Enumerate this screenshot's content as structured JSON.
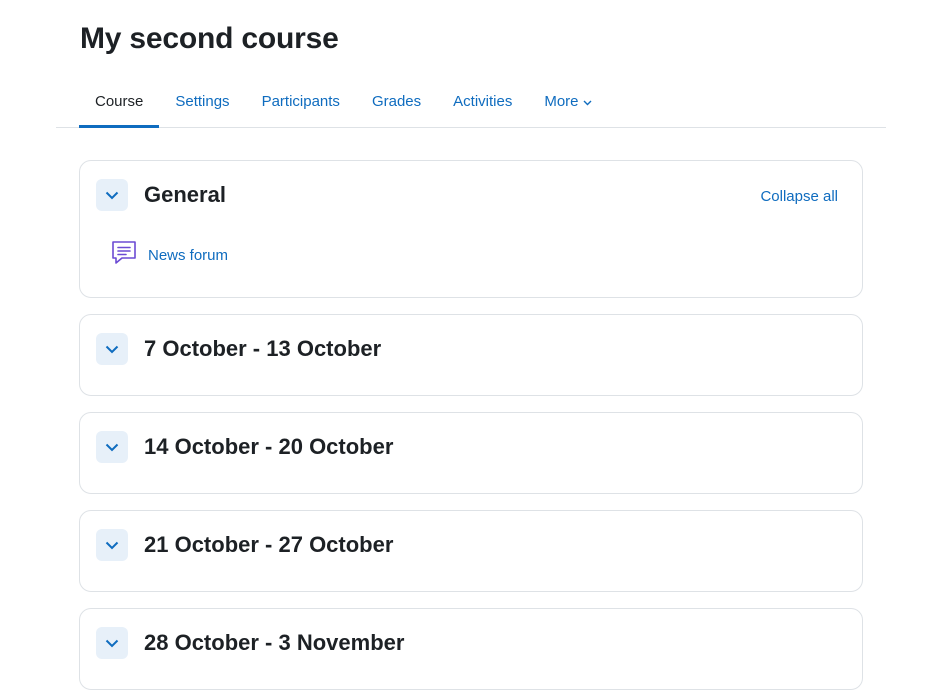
{
  "course": {
    "title": "My second course"
  },
  "nav": {
    "tabs": [
      {
        "label": "Course"
      },
      {
        "label": "Settings"
      },
      {
        "label": "Participants"
      },
      {
        "label": "Grades"
      },
      {
        "label": "Activities"
      },
      {
        "label": "More"
      }
    ],
    "active": "Course"
  },
  "sections": [
    {
      "title": "General",
      "collapse_all": "Collapse all",
      "activities": [
        {
          "name": "News forum",
          "icon": "forum-icon"
        }
      ]
    },
    {
      "title": "7 October - 13 October"
    },
    {
      "title": "14 October - 20 October"
    },
    {
      "title": "21 October - 27 October"
    },
    {
      "title": "28 October - 3 November"
    }
  ],
  "colors": {
    "link": "#0f6cbf",
    "text": "#1d2125",
    "border": "#dee2e6",
    "toggle_bg": "#e7f0f9",
    "forum_icon": "#6c4bd4"
  }
}
